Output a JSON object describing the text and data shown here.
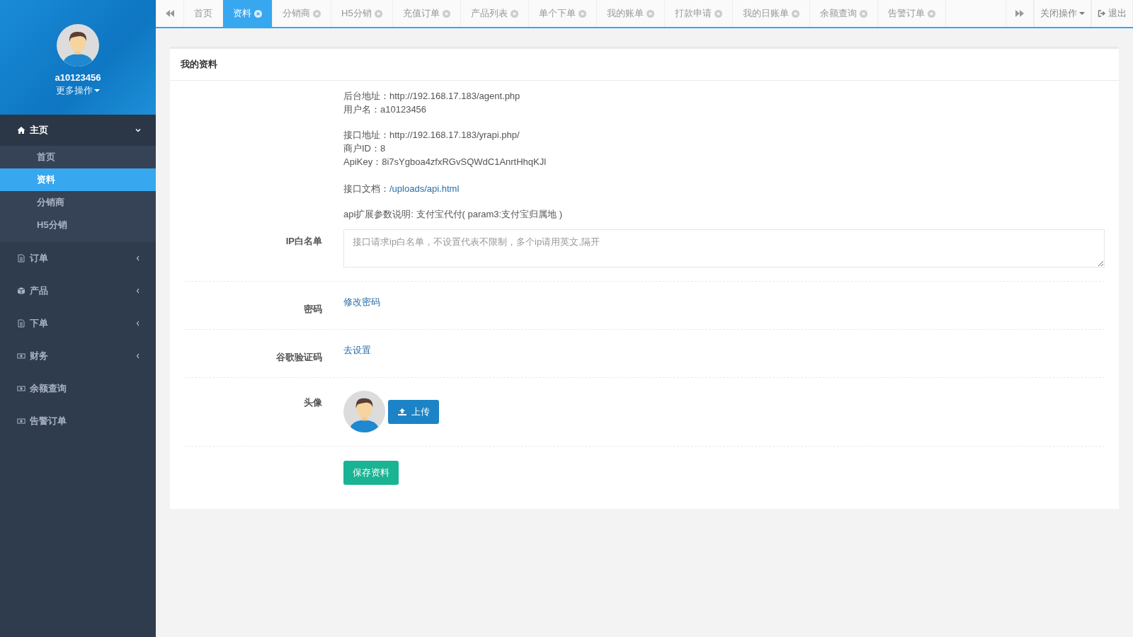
{
  "sidebar": {
    "user": {
      "name": "a10123456",
      "menu_label": "更多操作"
    },
    "nav": [
      {
        "label": "主页",
        "expanded": true,
        "children": [
          {
            "label": "首页",
            "selected": false
          },
          {
            "label": "资料",
            "selected": true
          },
          {
            "label": "分销商",
            "selected": false
          },
          {
            "label": "H5分销",
            "selected": false
          }
        ]
      },
      {
        "label": "订单",
        "expanded": false
      },
      {
        "label": "产品",
        "expanded": false
      },
      {
        "label": "下单",
        "expanded": false
      },
      {
        "label": "财务",
        "expanded": false
      },
      {
        "label": "余额查询"
      },
      {
        "label": "告警订单"
      }
    ]
  },
  "tabs": [
    {
      "label": "首页",
      "selected": false,
      "closable": false
    },
    {
      "label": "资料",
      "selected": true,
      "closable": true
    },
    {
      "label": "分销商",
      "selected": false,
      "closable": true
    },
    {
      "label": "H5分销",
      "selected": false,
      "closable": true
    },
    {
      "label": "充值订单",
      "selected": false,
      "closable": true
    },
    {
      "label": "产品列表",
      "selected": false,
      "closable": true
    },
    {
      "label": "单个下单",
      "selected": false,
      "closable": true
    },
    {
      "label": "我的账单",
      "selected": false,
      "closable": true
    },
    {
      "label": "打款申请",
      "selected": false,
      "closable": true
    },
    {
      "label": "我的日账单",
      "selected": false,
      "closable": true
    },
    {
      "label": "余额查询",
      "selected": false,
      "closable": true
    },
    {
      "label": "告警订单",
      "selected": false,
      "closable": true
    }
  ],
  "toolbar": {
    "close_menu": "关闭操作",
    "logout": "退出"
  },
  "card": {
    "title": "我的资料",
    "info_groups": [
      [
        {
          "label": "后台地址：",
          "value": "http://192.168.17.183/agent.php"
        },
        {
          "label": "用户名：",
          "value": "a10123456"
        }
      ],
      [
        {
          "label": "接口地址：",
          "value": "http://192.168.17.183/yrapi.php/"
        },
        {
          "label": "商户ID：",
          "value": "8"
        },
        {
          "label": "ApiKey：",
          "value": "8i7sYgboa4zfxRGvSQWdC1AnrtHhqKJl"
        }
      ],
      [
        {
          "label": "接口文档：",
          "value": "/uploads/api.html",
          "kind": "link"
        }
      ],
      [
        {
          "label": "api扩展参数说明: 支付宝代付( param3:支付宝归属地 )"
        }
      ]
    ],
    "ip_whitelist": {
      "label": "IP白名单",
      "placeholder": "接口请求ip白名单，不设置代表不限制，多个ip请用英文,隔开"
    },
    "password": {
      "label": "密码",
      "link": "修改密码"
    },
    "google_auth": {
      "label": "谷歌验证码",
      "link": "去设置"
    },
    "avatar": {
      "label": "头像",
      "upload_button": "上传"
    },
    "save_button": "保存资料"
  }
}
